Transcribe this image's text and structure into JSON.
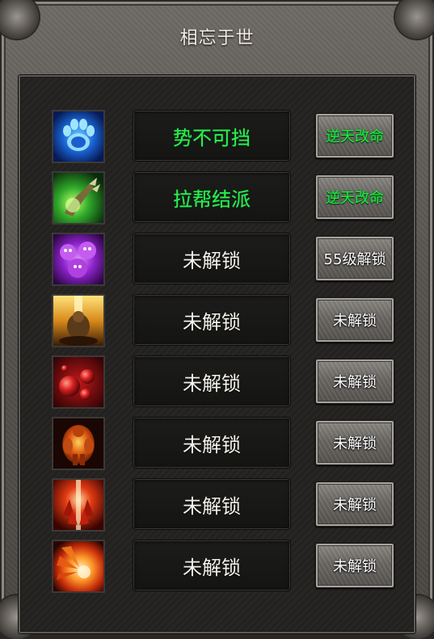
{
  "window": {
    "title": "相忘于世"
  },
  "skills": [
    {
      "name": "势不可挡",
      "name_state": "active",
      "action_label": "逆天改命",
      "action_style": "green",
      "icon": "blue-paw-icon"
    },
    {
      "name": "拉帮结派",
      "name_state": "active",
      "action_label": "逆天改命",
      "action_style": "green",
      "icon": "green-claw-icon"
    },
    {
      "name": "未解锁",
      "name_state": "locked",
      "action_label": "55级解锁",
      "action_style": "white",
      "icon": "purple-spirits-icon"
    },
    {
      "name": "未解锁",
      "name_state": "locked",
      "action_label": "未解锁",
      "action_style": "white",
      "icon": "golden-warrior-icon"
    },
    {
      "name": "未解锁",
      "name_state": "locked",
      "action_label": "未解锁",
      "action_style": "white",
      "icon": "red-orbs-icon"
    },
    {
      "name": "未解锁",
      "name_state": "locked",
      "action_label": "未解锁",
      "action_style": "white",
      "icon": "fire-brute-icon"
    },
    {
      "name": "未解锁",
      "name_state": "locked",
      "action_label": "未解锁",
      "action_style": "white",
      "icon": "red-crystal-icon"
    },
    {
      "name": "未解锁",
      "name_state": "locked",
      "action_label": "未解锁",
      "action_style": "white",
      "icon": "flame-burst-icon"
    }
  ],
  "colors": {
    "active_name": "#2bf04a",
    "locked_name": "#f4f1ea",
    "green_button_text": "#1ef03a",
    "white_button_text": "#ffffff"
  }
}
